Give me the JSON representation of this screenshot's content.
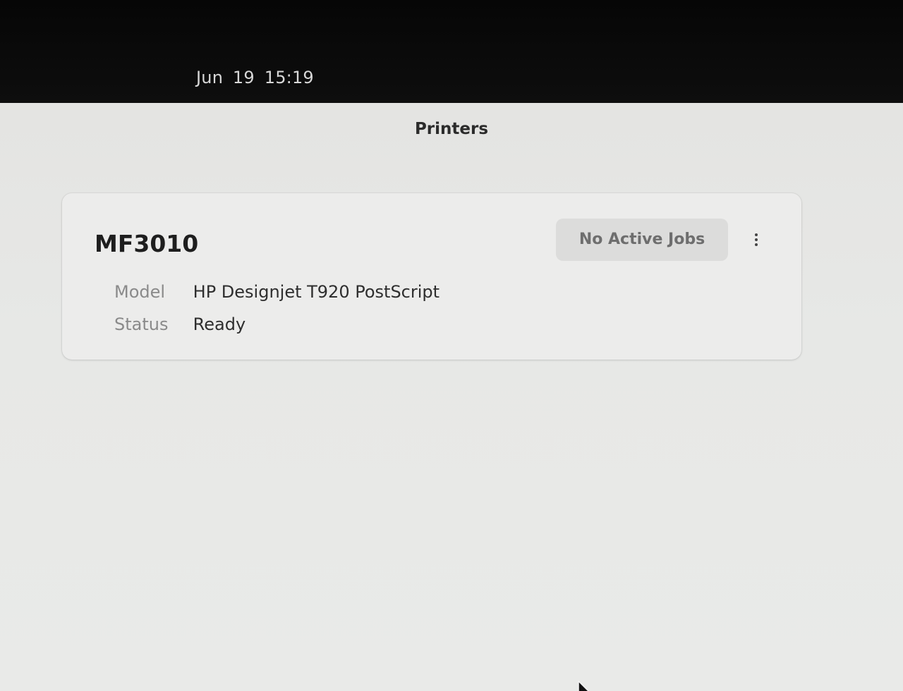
{
  "topbar": {
    "date": "Jun 19",
    "time": "15:19"
  },
  "window": {
    "title": "Printers"
  },
  "printer": {
    "name": "MF3010",
    "jobs_button_label": "No Active Jobs",
    "menu_icon": "vertical-ellipsis-icon",
    "details": {
      "model_label": "Model",
      "model_value": "HP Designjet T920 PostScript",
      "status_label": "Status",
      "status_value": "Ready"
    }
  }
}
